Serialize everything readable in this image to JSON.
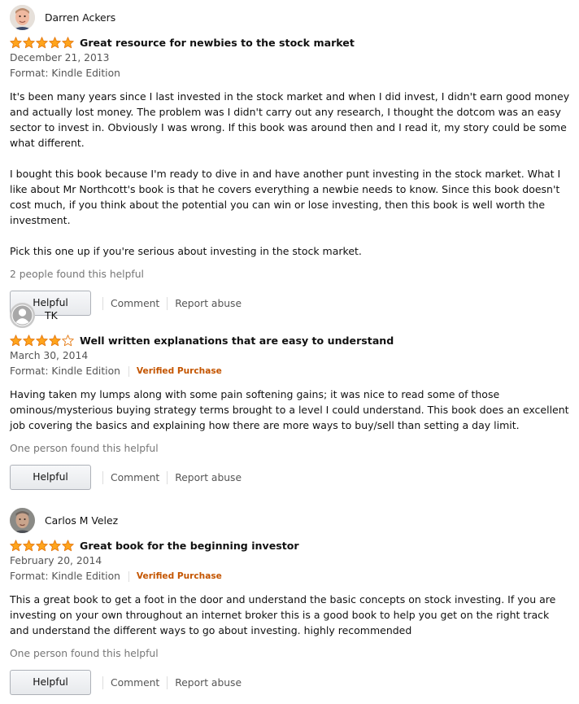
{
  "colors": {
    "star_fill": "#FFA41C",
    "star_stroke": "#E47911",
    "verified": "#C45500",
    "link": "#555555"
  },
  "reviews": [
    {
      "author": "Darren Ackers",
      "avatar": "person-photo-1",
      "rating": 5,
      "title": "Great resource for newbies to the stock market",
      "date": "December 21, 2013",
      "format": "Format: Kindle Edition",
      "verified": "",
      "paragraphs": [
        "It's been many years since I last invested in the stock market and when I did invest, I didn't earn good money and actually lost money. The problem was I didn't carry out any research, I thought the dotcom was an easy sector to invest in. Obviously I was wrong. If this book was around then and I read it, my story could be some what different.",
        "I bought this book because I'm ready to dive in and have another punt investing in the stock market. What I like about Mr Northcott's book is that he covers everything a newbie needs to know. Since this book doesn't cost much, if you think about the potential you can win or lose investing, then this book is well worth the investment.",
        "Pick this one up if you're serious about investing in the stock market."
      ],
      "helpful_count": "2 people found this helpful",
      "helpful_label": "Helpful",
      "comment_label": "Comment",
      "report_label": "Report abuse"
    },
    {
      "author": "TK",
      "avatar": "default-user-icon",
      "rating": 4,
      "title": "Well written explanations that are easy to understand",
      "date": "March 30, 2014",
      "format": "Format: Kindle Edition",
      "verified": "Verified Purchase",
      "paragraphs": [
        "Having taken my lumps along with some pain softening gains; it was nice to read some of those ominous/mysterious buying strategy terms brought to a level I could understand. This book does an excellent job covering the basics and explaining how there are more ways to buy/sell than setting a day limit."
      ],
      "helpful_count": "One person found this helpful",
      "helpful_label": "Helpful",
      "comment_label": "Comment",
      "report_label": "Report abuse"
    },
    {
      "author": "Carlos M Velez",
      "avatar": "person-photo-2",
      "rating": 5,
      "title": "Great book for the beginning investor",
      "date": "February 20, 2014",
      "format": "Format: Kindle Edition",
      "verified": "Verified Purchase",
      "paragraphs": [
        "This a great book to get a foot in the door and understand the basic concepts on stock investing. If you are investing on your own throughout an internet broker this is a good book to help you get on the right track and understand the different ways to go about investing. highly recommended"
      ],
      "helpful_count": "One person found this helpful",
      "helpful_label": "Helpful",
      "comment_label": "Comment",
      "report_label": "Report abuse"
    }
  ]
}
